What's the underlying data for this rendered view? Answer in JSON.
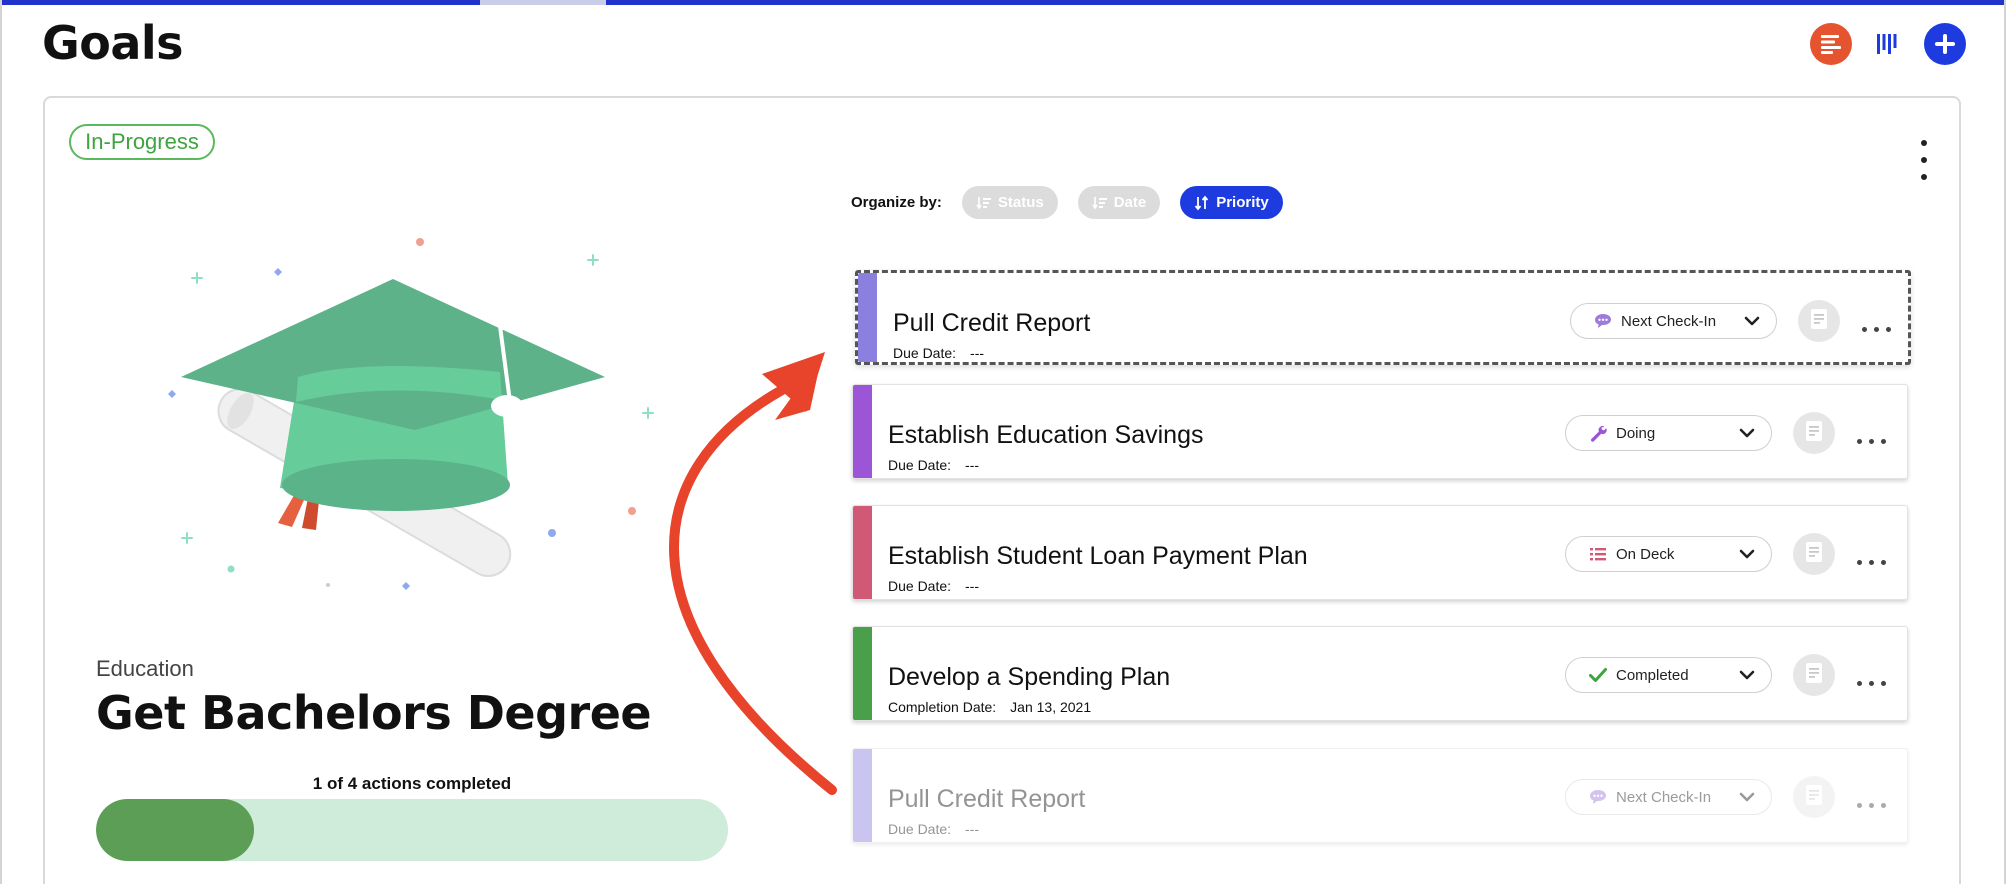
{
  "header": {
    "title": "Goals",
    "list_view_icon": "list-view-icon",
    "board_view_icon": "board-view-icon",
    "add_icon": "plus-icon"
  },
  "goal": {
    "status": "In-Progress",
    "category": "Education",
    "title": "Get Bachelors Degree",
    "progress_label": "1 of 4 actions completed",
    "progress_fraction": 0.25
  },
  "organize": {
    "label": "Organize by:",
    "options": [
      {
        "label": "Status",
        "active": false
      },
      {
        "label": "Date",
        "active": false
      },
      {
        "label": "Priority",
        "active": true
      }
    ]
  },
  "actions": [
    {
      "name": "Pull Credit Report",
      "due_label": "Due Date:",
      "due_value": "---",
      "status": "Next Check-In",
      "status_icon": "chat-bubble-icon",
      "color": "#8b80e0",
      "state": "dragging"
    },
    {
      "name": "Establish Education Savings",
      "due_label": "Due Date:",
      "due_value": "---",
      "status": "Doing",
      "status_icon": "wrench-icon",
      "color": "#9b55d6",
      "state": "normal"
    },
    {
      "name": "Establish Student Loan Payment Plan",
      "due_label": "Due Date:",
      "due_value": "---",
      "status": "On Deck",
      "status_icon": "list-icon",
      "color": "#d05a75",
      "state": "normal"
    },
    {
      "name": "Develop a Spending Plan",
      "due_label": "Completion Date:",
      "due_value": "Jan 13, 2021",
      "status": "Completed",
      "status_icon": "check-icon",
      "color": "#4aa04a",
      "state": "normal"
    },
    {
      "name": "Pull Credit Report",
      "due_label": "Due Date:",
      "due_value": "---",
      "status": "Next Check-In",
      "status_icon": "chat-bubble-icon",
      "color": "#8b80e0",
      "state": "ghost"
    }
  ],
  "colors": {
    "accent": "#1e3be0",
    "list_button": "#e5532f",
    "in_progress": "#3ea43e",
    "progress_fill": "#5c9e55",
    "progress_track": "#cfebd9",
    "arrow": "#e8432b"
  }
}
